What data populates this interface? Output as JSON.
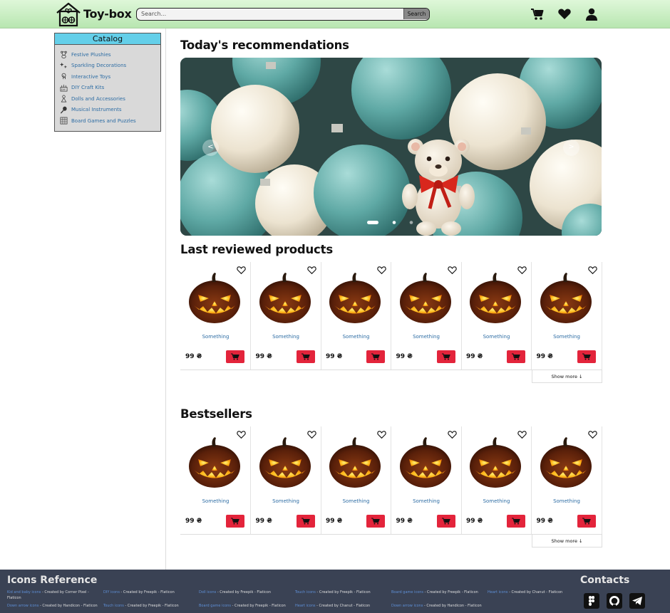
{
  "header": {
    "brand": "Toy-box",
    "search_placeholder": "Search...",
    "search_button": "Search",
    "icons": [
      "cart-icon",
      "heart-icon",
      "user-icon"
    ]
  },
  "catalog": {
    "title": "Catalog",
    "items": [
      {
        "label": "Festive Plushies",
        "icon": "teddy-icon"
      },
      {
        "label": "Sparkling Decorations",
        "icon": "sparkle-icon"
      },
      {
        "label": "Interactive Toys",
        "icon": "touch-icon"
      },
      {
        "label": "DIY Craft Kits",
        "icon": "diy-icon"
      },
      {
        "label": "Dolls and Accessories",
        "icon": "doll-icon"
      },
      {
        "label": "Musical Instruments",
        "icon": "maracas-icon"
      },
      {
        "label": "Board Games and Puzzles",
        "icon": "board-game-icon"
      }
    ]
  },
  "recommendations": {
    "title": "Today's recommendations",
    "prev": "<",
    "next": ">"
  },
  "last_reviewed": {
    "title": "Last reviewed products",
    "show_more": "Show more ↓",
    "products": [
      {
        "name": "Something",
        "price": "99 ₴"
      },
      {
        "name": "Something",
        "price": "99 ₴"
      },
      {
        "name": "Something",
        "price": "99 ₴"
      },
      {
        "name": "Something",
        "price": "99 ₴"
      },
      {
        "name": "Something",
        "price": "99 ₴"
      },
      {
        "name": "Something",
        "price": "99 ₴"
      }
    ]
  },
  "bestsellers": {
    "title": "Bestsellers",
    "show_more": "Show more ↓",
    "products": [
      {
        "name": "Something",
        "price": "99 ₴"
      },
      {
        "name": "Something",
        "price": "99 ₴"
      },
      {
        "name": "Something",
        "price": "99 ₴"
      },
      {
        "name": "Something",
        "price": "99 ₴"
      },
      {
        "name": "Something",
        "price": "99 ₴"
      },
      {
        "name": "Something",
        "price": "99 ₴"
      }
    ]
  },
  "footer": {
    "icons_title": "Icons Reference",
    "contacts_title": "Contacts",
    "credits": [
      {
        "link": "Kid and baby icons",
        "by": " - Created by Corner Pixel - Flaticon"
      },
      {
        "link": "DIY icons",
        "by": " - Created by Freepik - Flaticon"
      },
      {
        "link": "Doll icons",
        "by": " - Created by Freepik - Flaticon"
      },
      {
        "link": "Touch icons",
        "by": " - Created by Freepik - Flaticon"
      },
      {
        "link": "Board game icons",
        "by": " - Created by Freepik - Flaticon"
      },
      {
        "link": "Heart icons",
        "by": " - Created by Chanut - Flaticon"
      },
      {
        "link": "Down arrow icons",
        "by": " - Created by Handicon - Flaticon"
      },
      {
        "link": "Touch icons",
        "by": " - Created by Freepik - Flaticon"
      },
      {
        "link": "Board game icons",
        "by": " - Created by Freepik - Flaticon"
      },
      {
        "link": "Heart icons",
        "by": " - Created by Chanut - Flaticon"
      },
      {
        "link": "Down arrow icons",
        "by": " - Created by Handicon - Flaticon"
      }
    ],
    "socials": [
      "figma-icon",
      "github-icon",
      "telegram-icon"
    ]
  },
  "colors": {
    "header_gradient": [
      "#dff7d9",
      "#b8e6b0"
    ],
    "catalog_header": "#64cfe9",
    "cart_button": "#e3243b",
    "link": "#2e6da4",
    "footer_bg": "#3a4254"
  }
}
